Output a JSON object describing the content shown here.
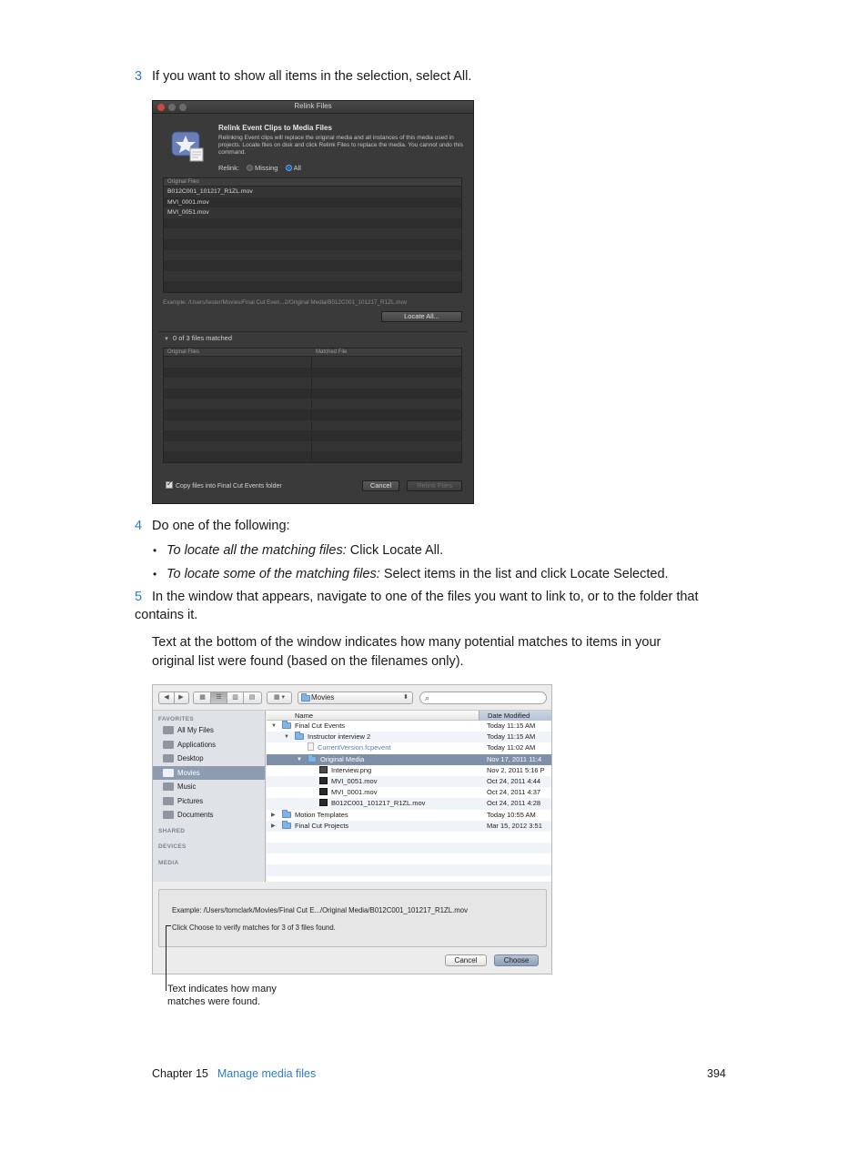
{
  "step3": {
    "num": "3",
    "text": "If you want to show all items in the selection, select All."
  },
  "relink_window": {
    "title": "Relink Files",
    "heading": "Relink Event Clips to Media Files",
    "description": "Relinking Event clips will replace the original media and all instances of this media used in projects. Locate files on disk and click Relink Files to replace the media. You cannot undo this command.",
    "relink_label": "Relink:",
    "option_missing": "Missing",
    "option_all": "All",
    "original_header": "Original Files",
    "files": [
      "B012C001_101217_R1ZL.mov",
      "MVI_0001.mov",
      "MVI_0051.mov"
    ],
    "example": "Example: /Users/tester/Movies/Final Cut Even...2/Original Media/B012C001_101217_R1ZL.mov",
    "locate_all": "Locate All...",
    "matched_summary": "0 of 3 files matched",
    "matched_col1": "Original Files",
    "matched_col2": "Matched File",
    "copy_label": "Copy files into Final Cut Events folder",
    "cancel": "Cancel",
    "relink_files": "Relink Files"
  },
  "step4": {
    "num": "4",
    "text": "Do one of the following:",
    "bullet1_em": "To locate all the matching files:",
    "bullet1_text": " Click Locate All.",
    "bullet2_em": "To locate some of the matching files:",
    "bullet2_text": " Select items in the list and click Locate Selected."
  },
  "step5": {
    "num": "5",
    "text": "In the window that appears, navigate to one of the files you want to link to, or to the folder that contains it.",
    "para": "Text at the bottom of the window indicates how many potential matches to items in your original list were found (based on the filenames only)."
  },
  "finder_window": {
    "path": "Movies",
    "sidebar": {
      "favorites": "FAVORITES",
      "items": [
        "All My Files",
        "Applications",
        "Desktop",
        "Movies",
        "Music",
        "Pictures",
        "Documents"
      ],
      "selected": "Movies",
      "shared": "SHARED",
      "devices": "DEVICES",
      "media": "MEDIA"
    },
    "col_name": "Name",
    "col_date": "Date Modified",
    "rows": [
      {
        "name": "Final Cut Events",
        "date": "Today 11:15 AM"
      },
      {
        "name": "Instructor interview 2",
        "date": "Today 11:15 AM"
      },
      {
        "name": "CurrentVersion.fcpevent",
        "date": "Today 11:02 AM"
      },
      {
        "name": "Original Media",
        "date": "Nov 17, 2011 11:4"
      },
      {
        "name": "Interview.png",
        "date": "Nov 2, 2011 5:16 P"
      },
      {
        "name": "MVI_0051.mov",
        "date": "Oct 24, 2011 4:44"
      },
      {
        "name": "MVI_0001.mov",
        "date": "Oct 24, 2011 4:37"
      },
      {
        "name": "B012C001_101217_R1ZL.mov",
        "date": "Oct 24, 2011 4:28"
      },
      {
        "name": "Motion Templates",
        "date": "Today 10:55 AM"
      },
      {
        "name": "Final Cut Projects",
        "date": "Mar 15, 2012 3:51"
      }
    ],
    "example": "Example:  /Users/tomclark/Movies/Final Cut E.../Original Media/B012C001_101217_R1ZL.mov",
    "choose_msg": "Click Choose to verify matches for 3 of 3 files found.",
    "cancel": "Cancel",
    "choose": "Choose"
  },
  "callout": "Text indicates how many matches were found.",
  "footer": {
    "chapter": "Chapter  15",
    "link": "Manage media files",
    "page": "394"
  }
}
